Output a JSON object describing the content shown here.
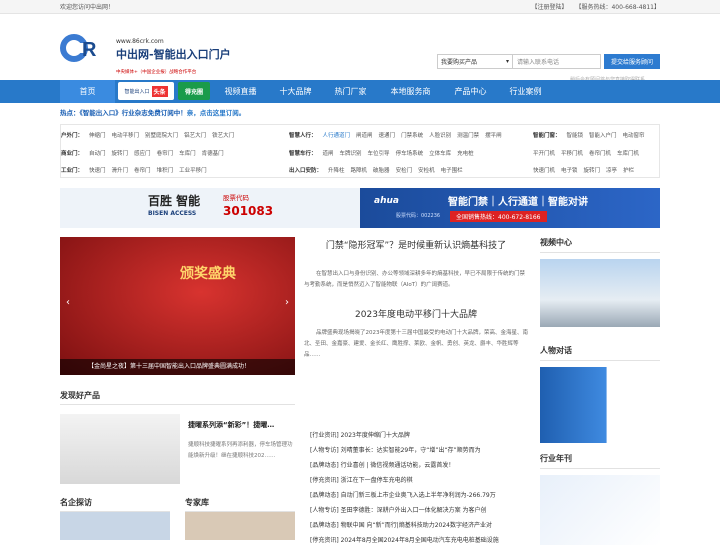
{
  "topbar": {
    "welcome": "欢迎您访问中出网！",
    "register": "【注册登陆】",
    "hotline": "【服务热线：400-668-4811】"
  },
  "header": {
    "url": "www.86crk.com",
    "title": "中出网-智能出入口门户",
    "slogan": "中央媒体+（中国企业报）战略合作平台"
  },
  "search": {
    "select": "我要购买产品",
    "placeholder": "请输入联系电话",
    "button": "提交给服务顾问",
    "tip": "稍后会有顾问将与您直接取得联系"
  },
  "nav": {
    "items": [
      "首页",
      "",
      "",
      "视频直播",
      "十大品牌",
      "热门厂家",
      "本地服务商",
      "产品中心",
      "行业案例"
    ],
    "ad1": "智能出入口",
    "ad1_badge": "头条",
    "ad2": "得充圈"
  },
  "hot": {
    "label": "热点：",
    "text": "《智能出入口》行业杂志免费订阅中！",
    "extra": "亲，点击这里订阅。"
  },
  "categories": {
    "row1": {
      "label": "户外门：",
      "items": [
        "伸缩门",
        "电动平移门",
        "别墅庭院大门",
        "铝艺大门",
        "铁艺大门"
      ]
    },
    "row2": {
      "label": "商业门：",
      "items": [
        "自动门",
        "旋转门",
        "感应门",
        "卷帘门",
        "车库门",
        "肯德基门"
      ]
    },
    "row3": {
      "label": "工业门：",
      "items": [
        "快速门",
        "滑升门",
        "卷帘门",
        "堆积门",
        "工业平移门"
      ]
    },
    "row4": {
      "label": "智慧人行：",
      "hl": "人行通道门",
      "items": [
        "闸道闸",
        "速通门",
        "门禁系统",
        "人脸识别",
        "测温门禁",
        "摆平闸"
      ]
    },
    "row5": {
      "label": "智慧车行：",
      "items": [
        "道闸",
        "车牌识别",
        "车位引导",
        "停车场系统",
        "立体车库",
        "充电桩"
      ]
    },
    "row6": {
      "label": "出入口安防：",
      "items": [
        "升降柱",
        "路障机",
        "破胎器",
        "安检门",
        "安检机",
        "电子围栏"
      ]
    },
    "row7": {
      "label": "智能门窗：",
      "items": [
        "智能锁",
        "智能入户门",
        "电动窗帘"
      ]
    },
    "row8": {
      "label": "",
      "items": [
        "平开门机",
        "平移门机",
        "卷帘门机",
        "车库门机"
      ]
    },
    "row9": {
      "label": "",
      "items": [
        "快速门机",
        "电子锁",
        "旋转门",
        "凉亭",
        "护栏"
      ]
    }
  },
  "banner": {
    "brand": "百胜 智能",
    "brand_en": "BISEN ACCESS",
    "code_label": "股票代码",
    "code": "301083",
    "ahua": "ahua",
    "ahua_code": "股票代码：002236",
    "slogan": "智能门禁｜人行通道｜智能对讲",
    "hotline": "全国销售热线：400-672-8166"
  },
  "slider": {
    "caption": "【金尚星之夜】第十三届中国智能出入口品牌盛典圆满成功！",
    "award": "颁奖盛典"
  },
  "center": {
    "title": "门禁“隐形冠军”？是时候重新认识熵基科技了",
    "para": "在智慧出入口与身份识别、办公等领域深耕多年的熵基科技，早已不局限于传统的门禁与考勤系统，而是悄然迈入了智能物联（AIoT）的广阔赛道。",
    "head": "2023年度电动平移门十大品牌",
    "para2": "品牌盛典现场揭晓了2023年度第十三届中国最受的电动门十大品牌，荣高、金海星、南北、圣田、金嘉豪、建爱、金长红、鹰胜撑、莱欧、金帆、勇创、英龙、爵丰、华胜辉等品……",
    "list": [
      "[行业资讯]  2023年度伸缩门十大品牌",
      "[人物专访]  刘晴董事长：达实智能29年，守“增”出“存”顺势而为",
      "[品牌动态]  行业喜创 | 微信视频通话功能，云露首发！",
      "[停充资讯]  浙江在下一盘停车充电的棋",
      "[品牌动态]  自动门新三板上市企业奥飞入选上半年净利润为-266.79万",
      "[人物专访]  圣田李德胜：深耕户外出入口一体化解决方案 为客户创",
      "[品牌动态]  物联中国 向“新”而行|熵基科技助力2024数字经济产业对",
      "[停充资讯]  2024年8月全国2024年8月全国电动汽车充电电桩基础设施"
    ]
  },
  "right": {
    "video": "视频中心",
    "people": "人物对话",
    "annual": "行业年刊"
  },
  "find": {
    "title": "发现好产品",
    "item_title": "捷曜系列添“新彩”！捷曜…",
    "item_desc": "捷顺科技捷曜系列再添利器，停车场管理功能焕新升级！继在捷顺科技202……"
  },
  "bottom": {
    "visit": "名企探访",
    "experts": "专家库"
  }
}
